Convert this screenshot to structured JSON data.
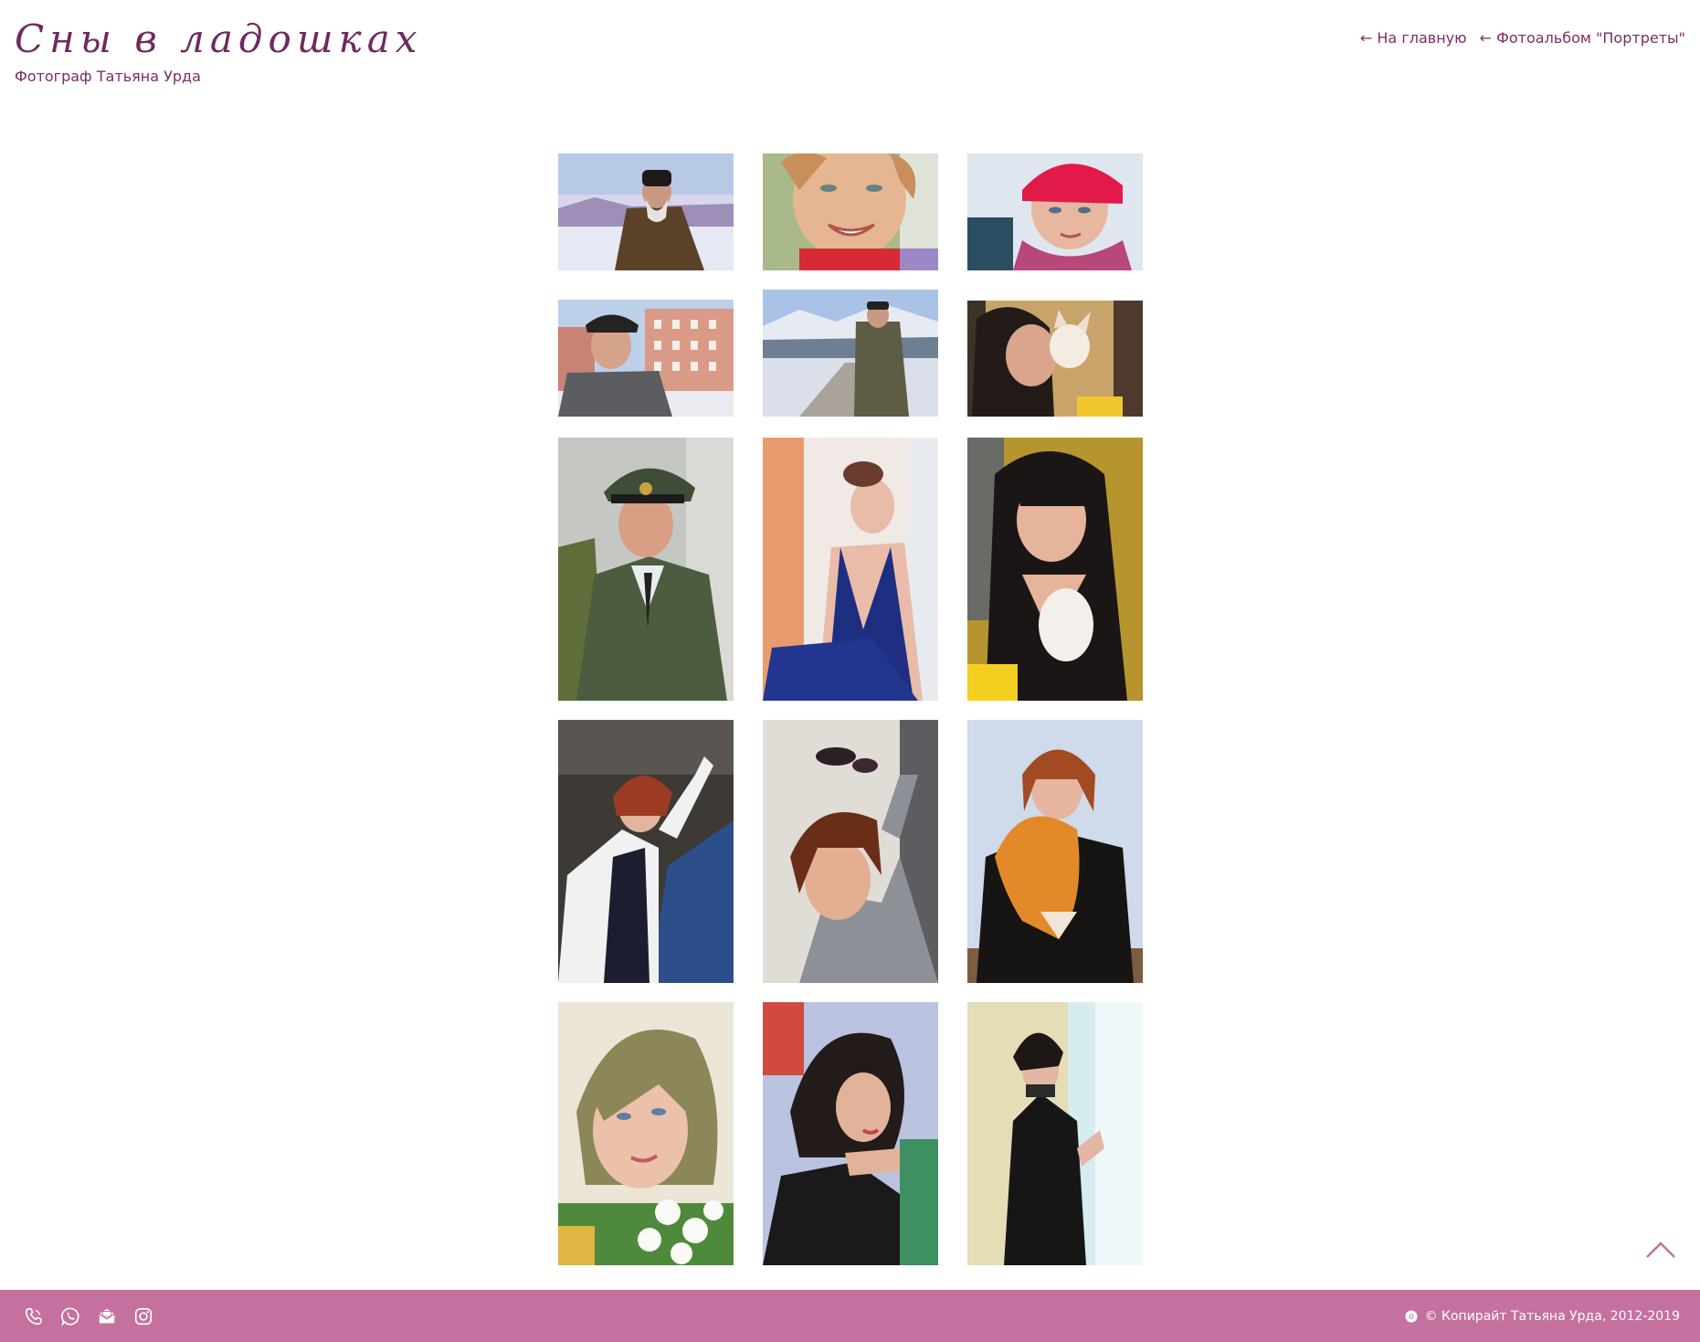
{
  "header": {
    "title": "Сны в ладошках",
    "subtitle": "Фотограф Татьяна Урда"
  },
  "nav": {
    "home": "← На главную",
    "album": "← Фотоальбом \"Портреты\""
  },
  "gallery": {
    "photos": [
      {
        "name": "photo-priest-winter",
        "orientation": "landscape"
      },
      {
        "name": "photo-woman-smiling",
        "orientation": "landscape"
      },
      {
        "name": "photo-woman-red-hat",
        "orientation": "landscape"
      },
      {
        "name": "photo-man-cap-city",
        "orientation": "landscape"
      },
      {
        "name": "photo-man-snowy-road",
        "orientation": "landscape"
      },
      {
        "name": "photo-woman-kissing-dog",
        "orientation": "landscape"
      },
      {
        "name": "photo-officer-uniform",
        "orientation": "portrait"
      },
      {
        "name": "photo-woman-blue-dress",
        "orientation": "portrait"
      },
      {
        "name": "photo-woman-holding-dog",
        "orientation": "portrait"
      },
      {
        "name": "photo-woman-white-jacket",
        "orientation": "portrait"
      },
      {
        "name": "photo-woman-sunglasses",
        "orientation": "portrait"
      },
      {
        "name": "photo-woman-fox",
        "orientation": "portrait"
      },
      {
        "name": "photo-woman-flowers",
        "orientation": "portrait"
      },
      {
        "name": "photo-woman-chin-hand",
        "orientation": "portrait"
      },
      {
        "name": "photo-woman-window",
        "orientation": "portrait"
      }
    ]
  },
  "footer": {
    "copyright": "© Копирайт Татьяна Урда, 2012-2019",
    "icons": [
      "phone-icon",
      "whatsapp-icon",
      "mail-icon",
      "instagram-icon"
    ]
  },
  "colors": {
    "accent": "#7a2e64",
    "footer_bg": "#c5719f"
  }
}
